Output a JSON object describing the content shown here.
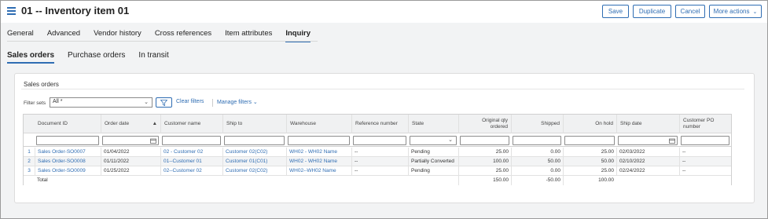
{
  "header": {
    "title": "01 -- Inventory item 01",
    "buttons": {
      "save": "Save",
      "duplicate": "Duplicate",
      "cancel": "Cancel",
      "more": "More actions"
    }
  },
  "tabs": [
    "General",
    "Advanced",
    "Vendor history",
    "Cross references",
    "Item attributes",
    "Inquiry"
  ],
  "active_tab": "Inquiry",
  "subtabs": [
    "Sales orders",
    "Purchase orders",
    "In transit"
  ],
  "active_subtab": "Sales orders",
  "section": {
    "title": "Sales orders",
    "filter_label": "Filter sets",
    "filter_value": "All *",
    "clear_filters": "Clear filters",
    "manage_filters": "Manage filters"
  },
  "table": {
    "columns": {
      "document_id": "Document ID",
      "order_date": "Order date",
      "customer_name": "Customer name",
      "ship_to": "Ship to",
      "warehouse": "Warehouse",
      "reference_number": "Reference number",
      "state": "State",
      "original_qty_line1": "Original qty",
      "original_qty_line2": "ordered",
      "shipped": "Shipped",
      "on_hold": "On hold",
      "ship_date": "Ship date",
      "customer_po_line1": "Customer PO",
      "customer_po_line2": "number"
    },
    "rows": [
      {
        "n": "1",
        "document_id": "Sales Order-SO0007",
        "order_date": "01/04/2022",
        "customer_name": "02 - Customer 02",
        "ship_to": "Customer 02(C02)",
        "warehouse": "WH02 - WH02 Name",
        "reference_number": "--",
        "state": "Pending",
        "original_qty": "25.00",
        "shipped": "0.00",
        "on_hold": "25.00",
        "ship_date": "02/03/2022",
        "customer_po": "--"
      },
      {
        "n": "2",
        "document_id": "Sales Order-SO0008",
        "order_date": "01/11/2022",
        "customer_name": "01--Customer 01",
        "ship_to": "Customer 01(C01)",
        "warehouse": "WH02 - WH02 Name",
        "reference_number": "--",
        "state": "Partially Converted",
        "original_qty": "100.00",
        "shipped": "50.00",
        "on_hold": "50.00",
        "ship_date": "02/10/2022",
        "customer_po": "--"
      },
      {
        "n": "3",
        "document_id": "Sales Order-SO0009",
        "order_date": "01/25/2022",
        "customer_name": "02--Customer 02",
        "ship_to": "Customer 02(C02)",
        "warehouse": "WH02--WH02 Name",
        "reference_number": "--",
        "state": "Pending",
        "original_qty": "25.00",
        "shipped": "0.00",
        "on_hold": "25.00",
        "ship_date": "02/24/2022",
        "customer_po": "--"
      }
    ],
    "total": {
      "label": "Total",
      "original_qty": "150.00",
      "shipped": "-50.00",
      "on_hold": "100.00"
    }
  }
}
